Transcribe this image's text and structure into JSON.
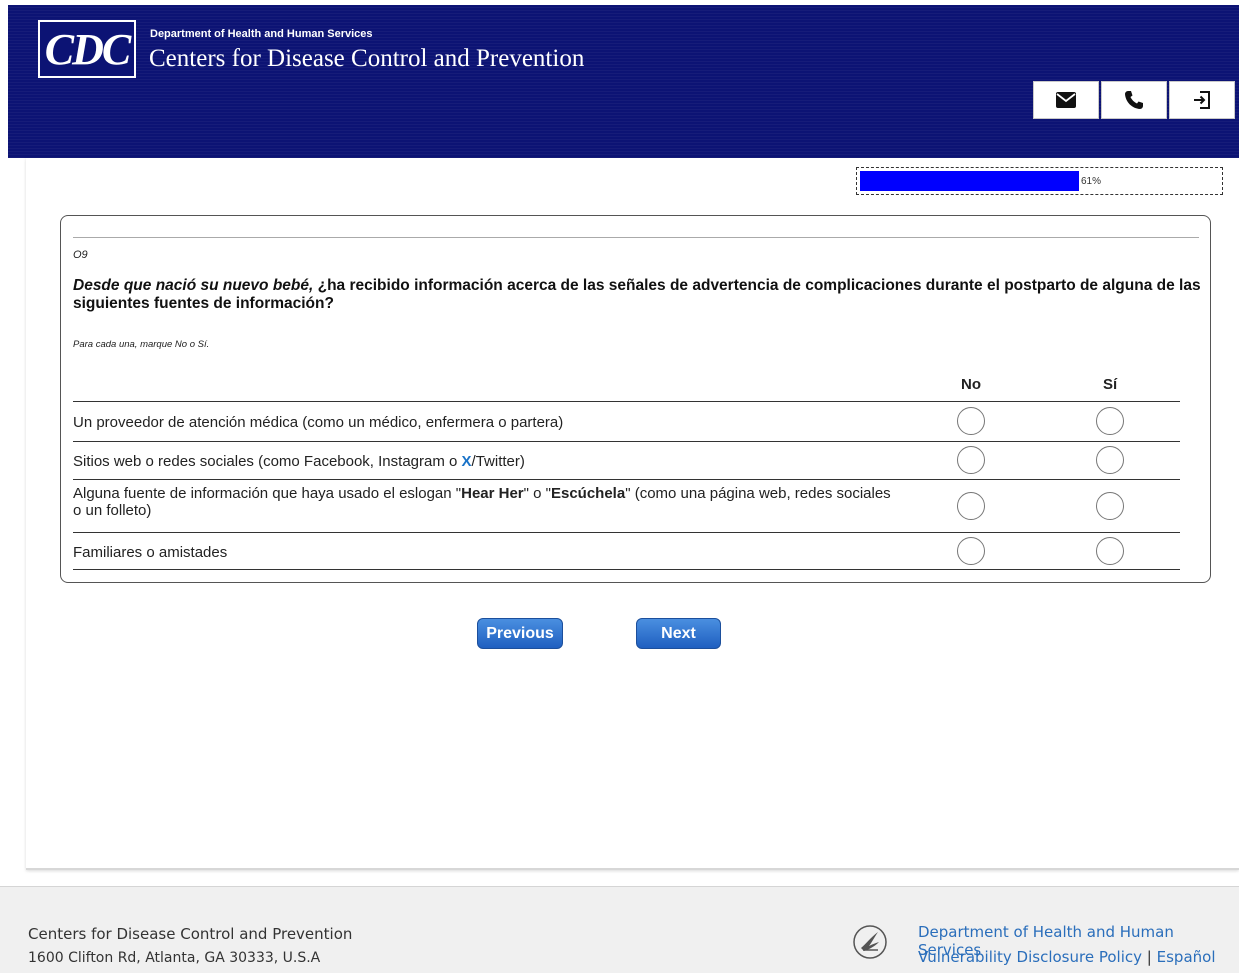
{
  "header": {
    "logo_text": "CDC",
    "department": "Department of Health and Human Services",
    "agency": "Centers for Disease Control and Prevention",
    "buttons": [
      {
        "icon": "mail-icon"
      },
      {
        "icon": "phone-icon"
      },
      {
        "icon": "exit-icon"
      }
    ]
  },
  "progress": {
    "value": 0.61,
    "label": "61%",
    "bar_color": "#0000ff"
  },
  "question": {
    "id": "O9",
    "text_italic": "Desde que nació su nuevo bebé,",
    "text_rest": " ¿ha recibido información acerca de las señales de advertencia de complicaciones durante el postparto de alguna de las siguientes fuentes de información?",
    "instruction": "Para cada una, marque No o Sí.",
    "columns": [
      "No",
      "Sí"
    ],
    "rows": [
      {
        "label": "Un proveedor de atención médica (como un médico, enfermera o partera)"
      },
      {
        "label_pre": "Sitios web o redes sociales (como Facebook, Instagram o ",
        "label_x": "X",
        "label_post": "/Twitter)"
      },
      {
        "label_a": "Alguna fuente de información que haya usado el eslogan \"",
        "label_b": "Hear Her",
        "label_c": "\" o \"",
        "label_d": "Escúchela",
        "label_e": "\" (como una página web, redes sociales o un folleto)"
      },
      {
        "label": "Familiares o amistades"
      }
    ]
  },
  "nav": {
    "previous_label": "Previous",
    "next_label": "Next"
  },
  "footer": {
    "org": "Centers for Disease Control and Prevention",
    "address": "1600 Clifton Rd, Atlanta, GA 30333, U.S.A",
    "hhs_link": "Department of Health and Human Services",
    "vdp_link": "Vulnerability Disclosure Policy",
    "separator": "|",
    "spanish_link": "Español"
  }
}
